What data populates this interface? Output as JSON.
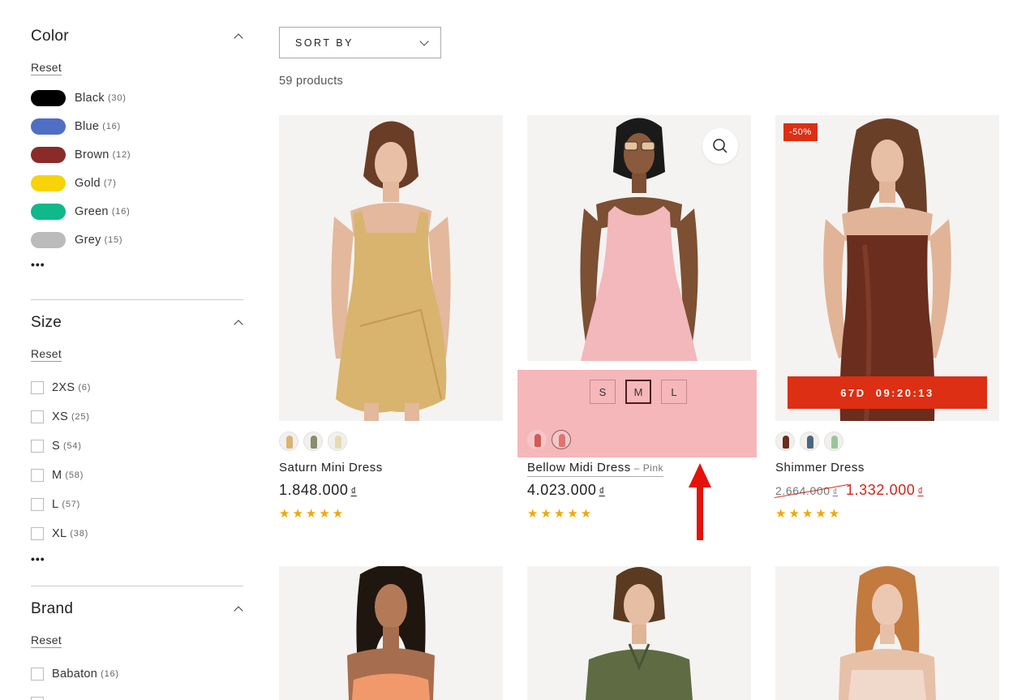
{
  "filters": {
    "color": {
      "title": "Color",
      "reset": "Reset",
      "items": [
        {
          "label": "Black",
          "count": "(30)",
          "swatch": "#000000"
        },
        {
          "label": "Blue",
          "count": "(16)",
          "swatch": "#4f6ec5"
        },
        {
          "label": "Brown",
          "count": "(12)",
          "swatch": "#8a2a2b"
        },
        {
          "label": "Gold",
          "count": "(7)",
          "swatch": "#f7d308"
        },
        {
          "label": "Green",
          "count": "(16)",
          "swatch": "#10b98a"
        },
        {
          "label": "Grey",
          "count": "(15)",
          "swatch": "#bbbbbb"
        }
      ],
      "more": "•••"
    },
    "size": {
      "title": "Size",
      "reset": "Reset",
      "items": [
        {
          "label": "2XS",
          "count": "(6)"
        },
        {
          "label": "XS",
          "count": "(25)"
        },
        {
          "label": "S",
          "count": "(54)"
        },
        {
          "label": "M",
          "count": "(58)"
        },
        {
          "label": "L",
          "count": "(57)"
        },
        {
          "label": "XL",
          "count": "(38)"
        }
      ],
      "more": "•••"
    },
    "brand": {
      "title": "Brand",
      "reset": "Reset",
      "items": [
        {
          "label": "Babaton",
          "count": "(16)"
        }
      ]
    }
  },
  "toolbar": {
    "sort_label": "SORT BY",
    "product_count": "59 products"
  },
  "products": [
    {
      "name": "Saturn Mini Dress",
      "price": "1.848.000",
      "currency": "₫",
      "rating": "★★★★★",
      "dress_color": "#d8b46f",
      "thumbs": [
        "#d8b46f",
        "#8a8c6c",
        "#e6dcb0"
      ]
    },
    {
      "name": "Bellow Midi Dress",
      "variant": "– Pink",
      "price": "4.023.000",
      "currency": "₫",
      "rating": "★★★★★",
      "dress_color": "#f2b8bc",
      "sizes": [
        "S",
        "M",
        "L"
      ],
      "selected_size": "M",
      "thumbs": [
        "#d05b57",
        "#e07272"
      ]
    },
    {
      "name": "Shimmer Dress",
      "badge": "-50%",
      "countdown": "67D 09:20:13",
      "price_old": "2.664.000",
      "price": "1.332.000",
      "currency": "₫",
      "rating": "★★★★★",
      "dress_color": "#6b2d1d",
      "thumbs": [
        "#6b2d1d",
        "#4b6680",
        "#9cc49a"
      ]
    },
    {
      "dress_color": "#f2996b"
    },
    {
      "dress_color": "#5f6b43"
    },
    {
      "dress_color": "#f0d8cb"
    }
  ],
  "colors": {
    "accent_red": "#dc2f14",
    "star_gold": "#f1a800",
    "annotation_panel": "#f6b7ba",
    "annotation_arrow": "#e3120b"
  }
}
